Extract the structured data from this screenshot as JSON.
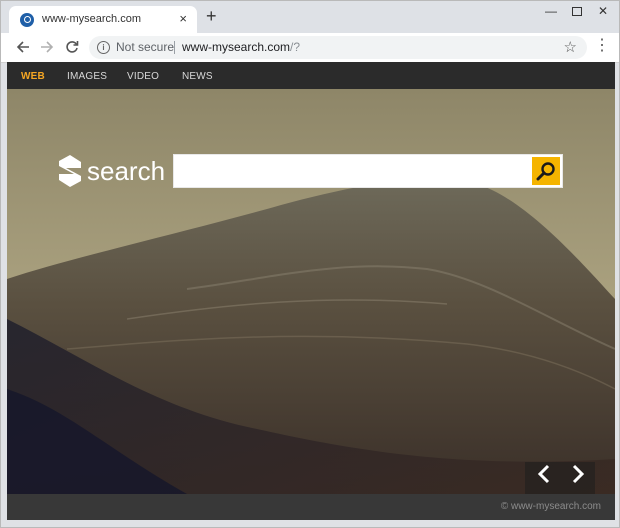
{
  "browser": {
    "tab": {
      "title": "www-mysearch.com",
      "close_label": "×"
    },
    "new_tab_label": "+",
    "window_controls": {
      "minimize": "—",
      "close": "✕"
    },
    "omnibox": {
      "security_text": "Not secure",
      "url_host": "www-mysearch.com",
      "url_path": "/?"
    }
  },
  "nav": {
    "items": [
      {
        "label": "WEB",
        "active": true
      },
      {
        "label": "IMAGES",
        "active": false
      },
      {
        "label": "VIDEO",
        "active": false
      },
      {
        "label": "NEWS",
        "active": false
      }
    ]
  },
  "logo": {
    "text": "search"
  },
  "search": {
    "value": "",
    "placeholder": ""
  },
  "footer": {
    "copyright": "© www-mysearch.com"
  },
  "colors": {
    "accent": "#f5a623",
    "search_button": "#f5b400",
    "navbar": "#2b2b2b",
    "footer": "#383838"
  },
  "icons": {
    "favicon": "search-favicon-icon",
    "back": "arrow-left-icon",
    "forward": "arrow-right-icon",
    "reload": "reload-icon",
    "info": "info-icon",
    "bookmark": "star-icon",
    "menu": "kebab-menu-icon",
    "search": "magnifier-icon",
    "prev": "chevron-left-icon",
    "next": "chevron-right-icon"
  }
}
